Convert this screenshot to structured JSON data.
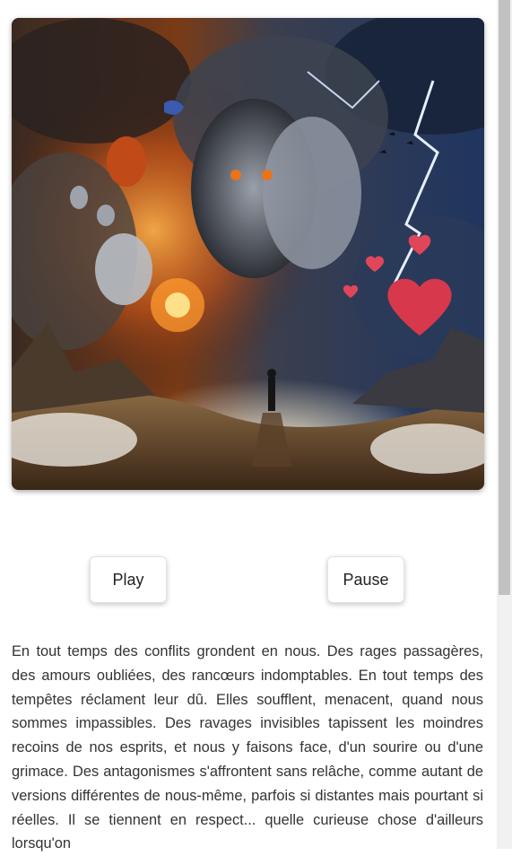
{
  "artwork": {
    "description_icon": "storm-faces-painting"
  },
  "controls": {
    "play_label": "Play",
    "pause_label": "Pause"
  },
  "story": {
    "text": "En tout temps des conflits grondent en nous. Des rages passagères, des amours oubliées, des rancœurs indomptables. En tout temps des tempêtes réclament leur dû. Elles soufflent, menacent, quand nous sommes impassibles. Des ravages invisibles tapissent les moindres recoins de nos esprits, et nous y faisons face, d'un sourire ou d'une grimace. Des antagonismes s'affrontent sans relâche, comme autant de versions différentes de nous-même, parfois si distantes mais pourtant si réelles. Il se tiennent en respect... quelle curieuse chose d'ailleurs lorsqu'on"
  },
  "colors": {
    "fire": "#e8741c",
    "storm": "#2a3f66",
    "sand": "#b08a5a",
    "heart": "#d8384c"
  }
}
